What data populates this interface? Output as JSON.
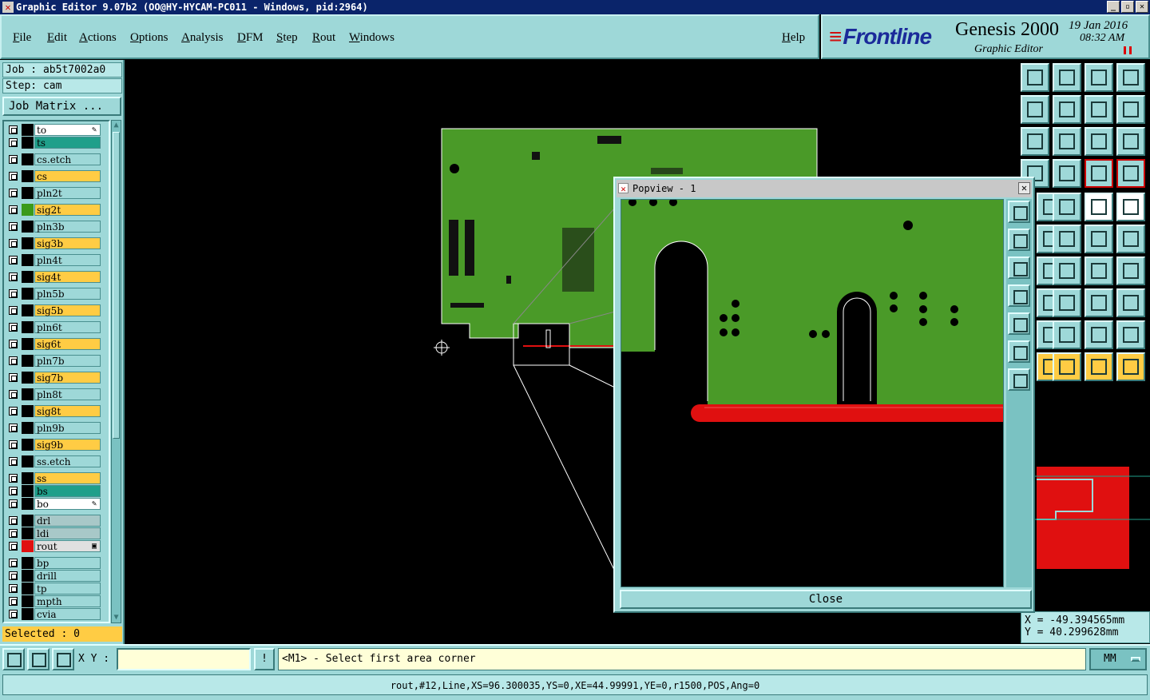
{
  "window": {
    "title": "Graphic Editor 9.07b2 (OO@HY-HYCAM-PC011 - Windows, pid:2964)",
    "buttons": [
      "_",
      "▫",
      "✕"
    ]
  },
  "menu": {
    "items": [
      "File",
      "Edit",
      "Actions",
      "Options",
      "Analysis",
      "DFM",
      "Step",
      "Rout",
      "Windows"
    ],
    "help": "Help"
  },
  "brand": {
    "logo": "Frontline",
    "product": "Genesis 2000",
    "subtitle": "Graphic Editor",
    "date": "19 Jan 2016",
    "time": "08:32 AM"
  },
  "job": {
    "job_label": "Job : ab5t7002a0",
    "step_label": "Step: cam",
    "matrix_button": "Job Matrix ..."
  },
  "layers": [
    {
      "name": "to",
      "color": "#000000",
      "bg": "#ffffff",
      "mark": "✎"
    },
    {
      "name": "ts",
      "color": "#000000",
      "bg": "#1f9f8a"
    },
    {
      "name": "cs.etch",
      "color": "#000000",
      "bg": "#9ed8d8"
    },
    {
      "name": "cs",
      "color": "#000000",
      "bg": "#ffcc44"
    },
    {
      "name": "pln2t",
      "color": "#000000",
      "bg": "#9ed8d8"
    },
    {
      "name": "sig2t",
      "color": "#3a9a1a",
      "bg": "#ffcc44"
    },
    {
      "name": "pln3b",
      "color": "#000000",
      "bg": "#9ed8d8"
    },
    {
      "name": "sig3b",
      "color": "#000000",
      "bg": "#ffcc44"
    },
    {
      "name": "pln4t",
      "color": "#000000",
      "bg": "#9ed8d8"
    },
    {
      "name": "sig4t",
      "color": "#000000",
      "bg": "#ffcc44"
    },
    {
      "name": "pln5b",
      "color": "#000000",
      "bg": "#9ed8d8"
    },
    {
      "name": "sig5b",
      "color": "#000000",
      "bg": "#ffcc44"
    },
    {
      "name": "pln6t",
      "color": "#000000",
      "bg": "#9ed8d8"
    },
    {
      "name": "sig6t",
      "color": "#000000",
      "bg": "#ffcc44"
    },
    {
      "name": "pln7b",
      "color": "#000000",
      "bg": "#9ed8d8"
    },
    {
      "name": "sig7b",
      "color": "#000000",
      "bg": "#ffcc44"
    },
    {
      "name": "pln8t",
      "color": "#000000",
      "bg": "#9ed8d8"
    },
    {
      "name": "sig8t",
      "color": "#000000",
      "bg": "#ffcc44"
    },
    {
      "name": "pln9b",
      "color": "#000000",
      "bg": "#9ed8d8"
    },
    {
      "name": "sig9b",
      "color": "#000000",
      "bg": "#ffcc44"
    },
    {
      "name": "ss.etch",
      "color": "#000000",
      "bg": "#9ed8d8"
    },
    {
      "name": "ss",
      "color": "#000000",
      "bg": "#ffcc44"
    },
    {
      "name": "bs",
      "color": "#000000",
      "bg": "#1f9f8a"
    },
    {
      "name": "bo",
      "color": "#000000",
      "bg": "#ffffff",
      "mark": "✎"
    },
    {
      "name": "drl",
      "color": "#000000",
      "bg": "#a8c8c8"
    },
    {
      "name": "ldi",
      "color": "#000000",
      "bg": "#a8c8c8"
    },
    {
      "name": "rout",
      "color": "#e01010",
      "bg": "#e0e0e0",
      "mark": "▣"
    },
    {
      "name": "bp",
      "color": "#000000",
      "bg": "#9ed8d8"
    },
    {
      "name": "drill",
      "color": "#000000",
      "bg": "#9ed8d8"
    },
    {
      "name": "tp",
      "color": "#000000",
      "bg": "#9ed8d8"
    },
    {
      "name": "mpth",
      "color": "#000000",
      "bg": "#9ed8d8"
    },
    {
      "name": "cvia",
      "color": "#000000",
      "bg": "#9ed8d8"
    }
  ],
  "selected": "Selected : 0",
  "popview": {
    "title": "Popview - 1",
    "close_label": "Close"
  },
  "coords": {
    "x": "X = -49.394565mm",
    "y": "Y = 40.299628mm"
  },
  "bottom": {
    "xy_label": "X Y :",
    "xy_value": "",
    "bang": "!",
    "prompt": "<M1> - Select first area corner",
    "units": "MM"
  },
  "status": "rout,#12,Line,XS=96.300035,YS=0,XE=44.99991,YE=0,r1500,POS,Ang=0",
  "colors": {
    "pcb_green": "#4a9a28",
    "rout_red": "#e01010",
    "panel": "#9ed8d8"
  }
}
